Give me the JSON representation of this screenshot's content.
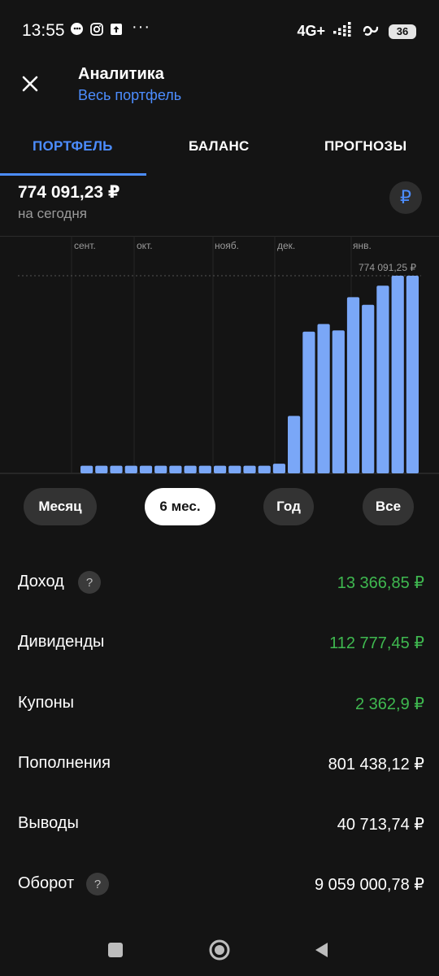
{
  "status_bar": {
    "time": "13:55",
    "icons_left": [
      "chat-bubble-icon",
      "instagram-icon",
      "upload-icon"
    ],
    "overflow": "···",
    "network": "4G+",
    "battery": "36"
  },
  "header": {
    "title": "Аналитика",
    "subtitle": "Весь портфель"
  },
  "tabs": [
    {
      "label": "ПОРТФЕЛЬ",
      "active": true
    },
    {
      "label": "БАЛАНС",
      "active": false
    },
    {
      "label": "ПРОГНОЗЫ",
      "active": false
    }
  ],
  "summary": {
    "amount": "774 091,23 ₽",
    "caption": "на сегодня",
    "currency_symbol": "₽"
  },
  "chart_data": {
    "type": "bar",
    "months": [
      "сент.",
      "окт.",
      "нояб.",
      "дек.",
      "янв."
    ],
    "max_label": "774 091,25 ₽",
    "ylim": [
      0,
      774091.25
    ],
    "values": [
      30000,
      30000,
      30000,
      30000,
      30000,
      30000,
      30000,
      30000,
      30000,
      30000,
      30000,
      30000,
      30000,
      38000,
      225000,
      555000,
      585000,
      560000,
      690000,
      660000,
      735000,
      774091.25,
      774091.25
    ],
    "bar_color": "#7aa7f7"
  },
  "periods": [
    {
      "label": "Месяц",
      "active": false
    },
    {
      "label": "6 мес.",
      "active": true
    },
    {
      "label": "Год",
      "active": false
    },
    {
      "label": "Все",
      "active": false
    }
  ],
  "stats": [
    {
      "label": "Доход",
      "value": "13 366,85 ₽",
      "positive": true,
      "help": "?"
    },
    {
      "label": "Дивиденды",
      "value": "112 777,45 ₽",
      "positive": true
    },
    {
      "label": "Купоны",
      "value": "2 362,9 ₽",
      "positive": true
    },
    {
      "label": "Пополнения",
      "value": "801 438,12 ₽",
      "positive": false
    },
    {
      "label": "Выводы",
      "value": "40 713,74 ₽",
      "positive": false
    },
    {
      "label": "Оборот",
      "value": "9 059 000,78 ₽",
      "positive": false,
      "help": "?"
    }
  ],
  "colors": {
    "background": "#141414",
    "accent": "#4c8dff",
    "positive": "#3fb950",
    "bar": "#7aa7f7"
  }
}
